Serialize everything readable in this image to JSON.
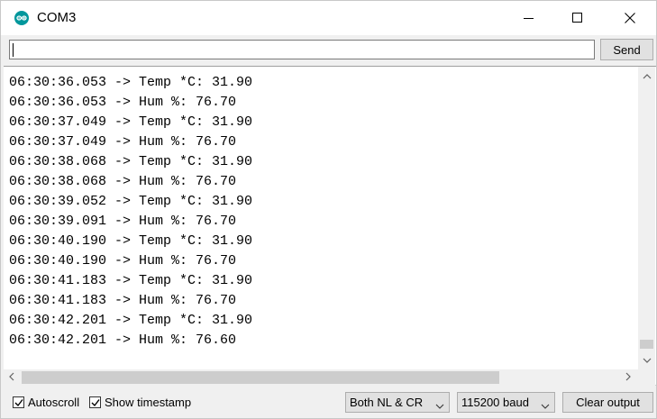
{
  "window": {
    "title": "COM3"
  },
  "send_row": {
    "input_value": "",
    "send_label": "Send"
  },
  "output": {
    "lines": [
      "06:30:36.053 -> Temp *C: 31.90",
      "06:30:36.053 -> Hum %: 76.70",
      "06:30:37.049 -> Temp *C: 31.90",
      "06:30:37.049 -> Hum %: 76.70",
      "06:30:38.068 -> Temp *C: 31.90",
      "06:30:38.068 -> Hum %: 76.70",
      "06:30:39.052 -> Temp *C: 31.90",
      "06:30:39.091 -> Hum %: 76.70",
      "06:30:40.190 -> Temp *C: 31.90",
      "06:30:40.190 -> Hum %: 76.70",
      "06:30:41.183 -> Temp *C: 31.90",
      "06:30:41.183 -> Hum %: 76.70",
      "06:30:42.201 -> Temp *C: 31.90",
      "06:30:42.201 -> Hum %: 76.60"
    ]
  },
  "footer": {
    "autoscroll_label": "Autoscroll",
    "autoscroll_checked": true,
    "timestamp_label": "Show timestamp",
    "timestamp_checked": true,
    "line_ending": "Both NL & CR",
    "baud_rate": "115200 baud",
    "clear_label": "Clear output"
  },
  "colors": {
    "app_icon": "#00979c",
    "background": "#f0f0f0",
    "output_bg": "#ffffff"
  },
  "icons": {
    "app": "arduino-icon",
    "minimize": "minimize-icon",
    "maximize": "maximize-icon",
    "close": "close-icon"
  }
}
